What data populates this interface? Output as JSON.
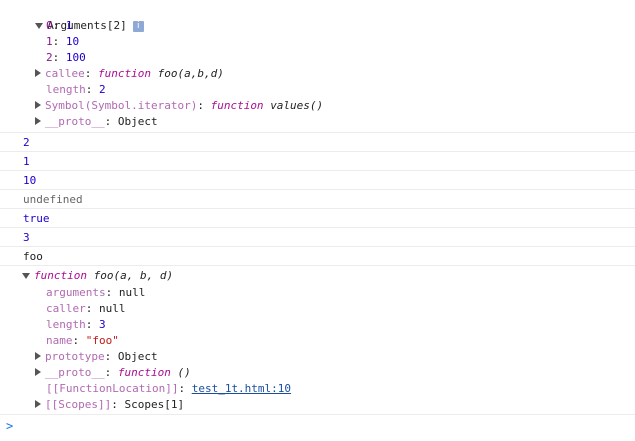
{
  "arguments_obj": {
    "header": "Arguments[2]",
    "items": [
      {
        "k": "0",
        "v": "1"
      },
      {
        "k": "1",
        "v": "10"
      },
      {
        "k": "2",
        "v": "100"
      }
    ],
    "callee_key": "callee",
    "callee_kw": "function",
    "callee_sig": "foo(a,b,d)",
    "length_key": "length",
    "length_val": "2",
    "iter_key": "Symbol(Symbol.iterator)",
    "iter_kw": "function",
    "iter_sig": "values()",
    "proto_key": "__proto__",
    "proto_val": "Object"
  },
  "outputs": [
    "2",
    "1",
    "10",
    "undefined",
    "true",
    "3",
    "foo"
  ],
  "function_obj": {
    "kw": "function",
    "sig": "foo(a, b, d)",
    "arguments_key": "arguments",
    "arguments_val": "null",
    "caller_key": "caller",
    "caller_val": "null",
    "length_key": "length",
    "length_val": "3",
    "name_key": "name",
    "name_val": "\"foo\"",
    "prototype_key": "prototype",
    "prototype_val": "Object",
    "proto_key": "__proto__",
    "proto_kw": "function",
    "proto_sig": "()",
    "location_key": "[[FunctionLocation]]",
    "location_val": "test_1t.html:10",
    "scopes_key": "[[Scopes]]",
    "scopes_val": "Scopes[1]"
  },
  "prompt_symbol": ">"
}
